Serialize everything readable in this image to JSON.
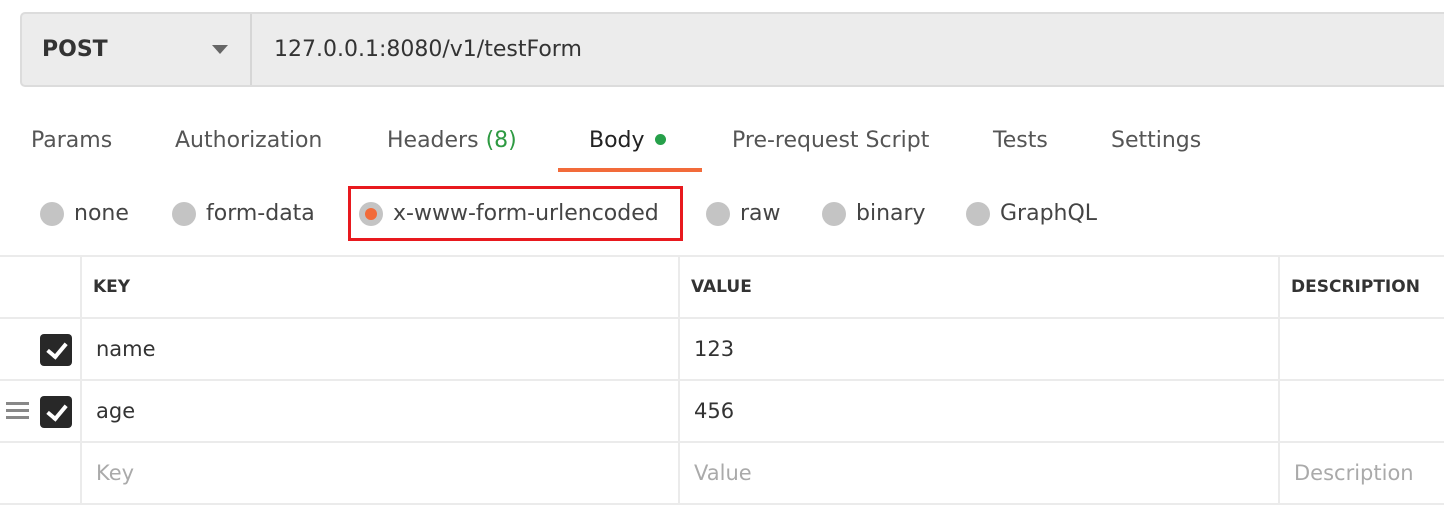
{
  "request": {
    "method": "POST",
    "url": "127.0.0.1:8080/v1/testForm"
  },
  "tabs": [
    {
      "label": "Params"
    },
    {
      "label": "Authorization"
    },
    {
      "label": "Headers",
      "count": "(8)"
    },
    {
      "label": "Body",
      "active": true
    },
    {
      "label": "Pre-request Script"
    },
    {
      "label": "Tests"
    },
    {
      "label": "Settings"
    }
  ],
  "body_types": [
    {
      "label": "none"
    },
    {
      "label": "form-data"
    },
    {
      "label": "x-www-form-urlencoded",
      "selected": true
    },
    {
      "label": "raw"
    },
    {
      "label": "binary"
    },
    {
      "label": "GraphQL"
    }
  ],
  "table": {
    "headers": [
      "KEY",
      "VALUE",
      "DESCRIPTION"
    ],
    "rows": [
      {
        "checked": true,
        "key": "name",
        "value": "123",
        "description": ""
      },
      {
        "checked": true,
        "key": "age",
        "value": "456",
        "description": ""
      }
    ],
    "placeholders": {
      "key": "Key",
      "value": "Value",
      "description": "Description"
    }
  },
  "colors": {
    "accent": "#f26b3a",
    "active_dot": "#26a04a",
    "highlight": "#e8191e"
  }
}
